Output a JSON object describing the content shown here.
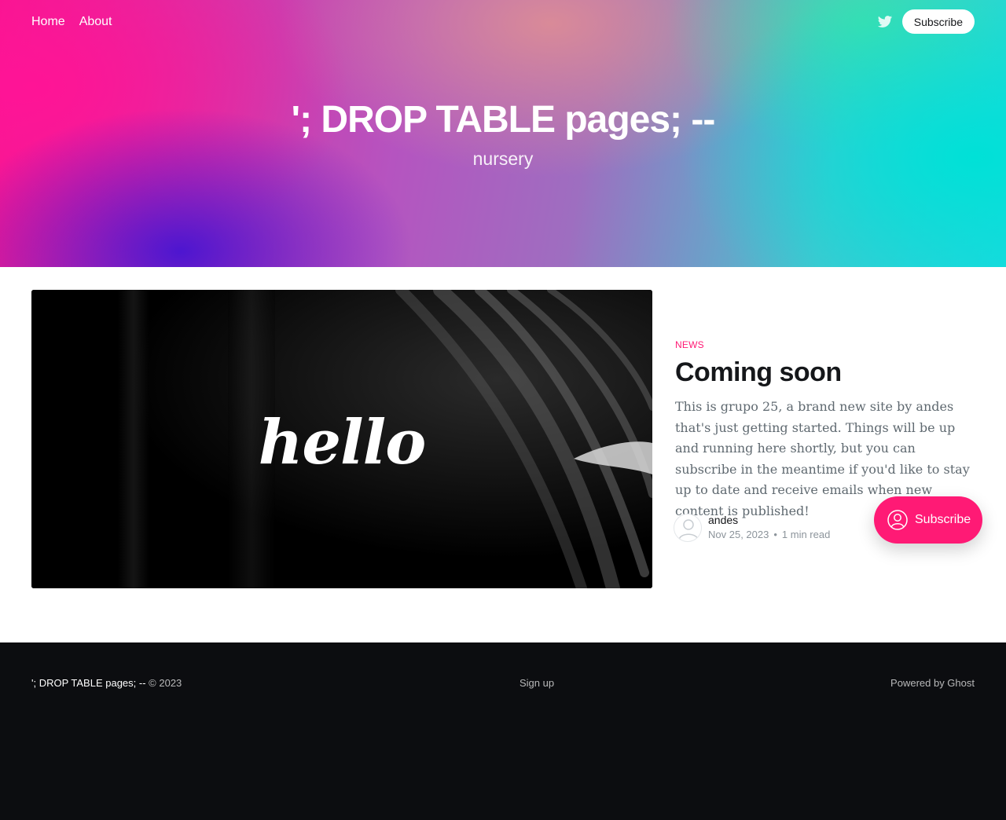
{
  "header": {
    "nav": [
      {
        "label": "Home"
      },
      {
        "label": "About"
      }
    ],
    "social_icon": "twitter-icon",
    "subscribe_label": "Subscribe",
    "site_title": "'; DROP TABLE pages; --",
    "site_description": "nursery"
  },
  "feature_post": {
    "image_text": "hello",
    "tag": "News",
    "title": "Coming soon",
    "excerpt": "This is grupo 25, a brand new site by andes that's just getting started. Things will be up and running here shortly, but you can subscribe in the meantime if you'd like to stay up to date and receive emails when new content is published!",
    "author": "andes",
    "date": "Nov 25, 2023",
    "separator": "•",
    "reading_time": "1 min read"
  },
  "portal": {
    "label": "Subscribe",
    "icon": "user-circle-icon"
  },
  "footer": {
    "site_title": "'; DROP TABLE pages; --",
    "copyright": "© 2023",
    "signup_label": "Sign up",
    "powered_by": "Powered by Ghost"
  },
  "colors": {
    "accent": "#ff1a75",
    "footer_bg": "#0c0d10",
    "text_dark": "#15171a"
  }
}
